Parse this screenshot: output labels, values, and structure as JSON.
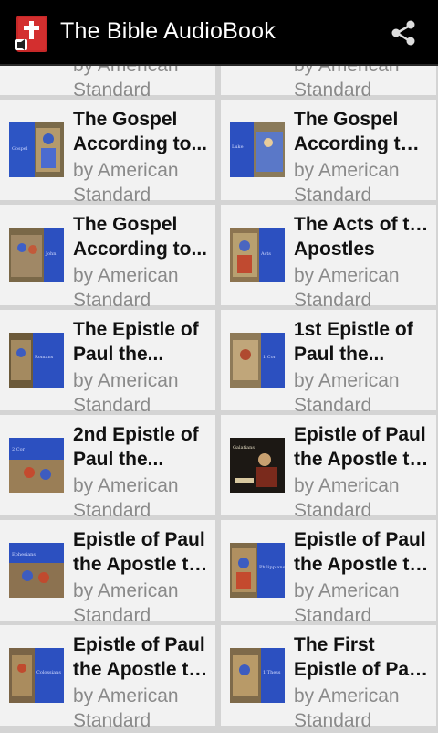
{
  "app": {
    "title": "The Bible AudioBook",
    "accent": "#c62828"
  },
  "toolbar": {
    "share_icon": "share-icon"
  },
  "partial_row": [
    {
      "author_l1": "by American",
      "author_l2": "Standard"
    },
    {
      "author_l1": "by American",
      "author_l2": "Standard"
    }
  ],
  "books": [
    {
      "title_l1": "The Gospel",
      "title_l2": "According to...",
      "author_l1": "by American",
      "author_l2": "Standard",
      "cover": "#253f9c"
    },
    {
      "title_l1": "The Gospel",
      "title_l2": "According to ...",
      "author_l1": "by American",
      "author_l2": "Standard",
      "cover": "#2747a8"
    },
    {
      "title_l1": "The Gospel",
      "title_l2": "According to...",
      "author_l1": "by American",
      "author_l2": "Standard",
      "cover": "#27419a"
    },
    {
      "title_l1": "The Acts of the",
      "title_l2": "Apostles",
      "author_l1": "by American",
      "author_l2": "Standard",
      "cover": "#2a48a4"
    },
    {
      "title_l1": "The Epistle of",
      "title_l2": "Paul the...",
      "author_l1": "by American",
      "author_l2": "Standard",
      "cover": "#2443a3"
    },
    {
      "title_l1": "1st Epistle of",
      "title_l2": "Paul the...",
      "author_l1": "by American",
      "author_l2": "Standard",
      "cover": "#2645a3"
    },
    {
      "title_l1": "2nd Epistle of",
      "title_l2": "Paul the...",
      "author_l1": "by American",
      "author_l2": "Standard",
      "cover": "#2a4bb0"
    },
    {
      "title_l1": "Epistle of Paul",
      "title_l2": "the Apostle to...",
      "author_l1": "by American",
      "author_l2": "Standard",
      "cover": "#1a1a1a"
    },
    {
      "title_l1": "Epistle of Paul",
      "title_l2": "the Apostle to...",
      "author_l1": "by American",
      "author_l2": "Standard",
      "cover": "#2344a6"
    },
    {
      "title_l1": "Epistle of Paul",
      "title_l2": "the Apostle to...",
      "author_l1": "by American",
      "author_l2": "Standard",
      "cover": "#2a4bb0"
    },
    {
      "title_l1": "Epistle of Paul",
      "title_l2": "the Apostle to...",
      "author_l1": "by American",
      "author_l2": "Standard",
      "cover": "#2649ab"
    },
    {
      "title_l1": "The First",
      "title_l2": "Epistle of Paul...",
      "author_l1": "by American",
      "author_l2": "Standard",
      "cover": "#2646a8"
    }
  ]
}
